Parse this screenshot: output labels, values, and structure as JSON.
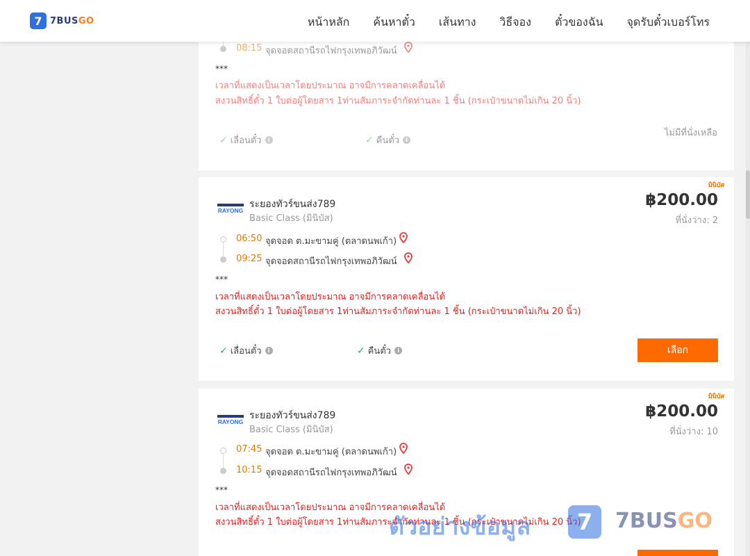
{
  "header": {
    "logo_mark": "7",
    "logo_text_main": "7BUS",
    "logo_text_accent": "GO",
    "nav": [
      "หน้าหลัก",
      "ค้นหาตั๋ว",
      "เส้นทาง",
      "วิธีจอง",
      "ตั๋วของฉัน",
      "จุดรับตั๋วเบอร์โทร"
    ]
  },
  "colors": {
    "accent": "#ff6a00",
    "brand_blue": "#2f6fe0",
    "warning_red": "#e02020",
    "departure_time": "#e07a00"
  },
  "card_top": {
    "arrival_time": "08:15",
    "arrival_stop": "จุดจอดสถานีรถไฟกรุงเทพอภิวัฒน์",
    "stars": "***",
    "note1": "เวลาที่แสดงเป็นเวลาโดยประมาณ อาจมีการคลาดเคลื่อนได้",
    "note2": "สงวนสิทธิ์ตั๋ว 1 ใบต่อผู้โดยสาร 1ท่านสัมภาระจำกัดท่านละ 1 ชิ้น (กระเป๋าขนาดไม่เกิน 20 นิ้ว)",
    "perk1": "เลื่อนตั๋ว",
    "perk2": "คืนตั๋ว",
    "status": "ไม่มีที่นั่งเหลือ"
  },
  "cards": [
    {
      "tag": "มินิบัส",
      "operator_logo": "RAYONG",
      "operator": "ระยองทัวร์ขนส่ง789",
      "class": "Basic Class (มินิบัส)",
      "price": "฿200.00",
      "seats": "ที่นั่งว่าง: 2",
      "departure_time": "06:50",
      "departure_stop": "จุดจอด ต.มะขามคู่ (ตลาดนพเก้า)",
      "arrival_time": "09:25",
      "arrival_stop": "จุดจอดสถานีรถไฟกรุงเทพอภิวัฒน์",
      "stars": "***",
      "note1": "เวลาที่แสดงเป็นเวลาโดยประมาณ อาจมีการคลาดเคลื่อนได้",
      "note2": "สงวนสิทธิ์ตั๋ว 1 ใบต่อผู้โดยสาร 1ท่านสัมภาระจำกัดท่านละ 1 ชิ้น (กระเป๋าขนาดไม่เกิน 20 นิ้ว)",
      "perk1": "เลื่อนตั๋ว",
      "perk2": "คืนตั๋ว",
      "button": "เลือก"
    },
    {
      "tag": "มินิบัส",
      "operator_logo": "RAYONG",
      "operator": "ระยองทัวร์ขนส่ง789",
      "class": "Basic Class (มินิบัส)",
      "price": "฿200.00",
      "seats": "ที่นั่งว่าง: 10",
      "departure_time": "07:45",
      "departure_stop": "จุดจอด ต.มะขามคู่ (ตลาดนพเก้า)",
      "arrival_time": "10:15",
      "arrival_stop": "จุดจอดสถานีรถไฟกรุงเทพอภิวัฒน์",
      "stars": "***",
      "note1": "เวลาที่แสดงเป็นเวลาโดยประมาณ อาจมีการคลาดเคลื่อนได้",
      "note2": "สงวนสิทธิ์ตั๋ว 1 ใบต่อผู้โดยสาร 1ท่านสัมภาระจำกัดท่านละ 1 ชิ้น (กระเป๋าขนาดไม่เกิน 20 นิ้ว)"
    }
  ],
  "watermark": {
    "text": "ตัวอย่างข้อมูล",
    "mark": "7",
    "brand_main": "7BUS",
    "brand_accent": "GO"
  }
}
